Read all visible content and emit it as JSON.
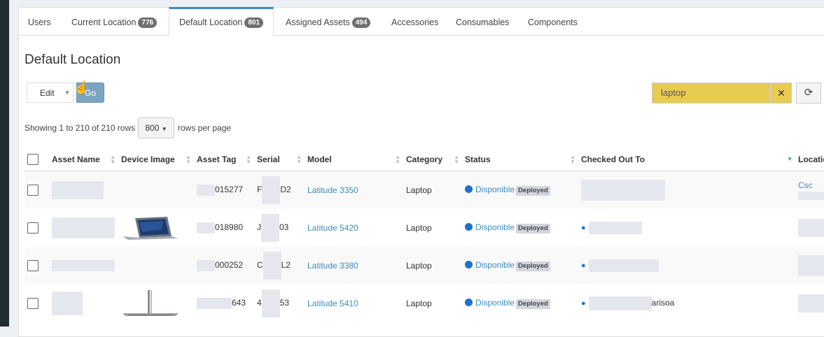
{
  "tabs": [
    {
      "label": "Users",
      "badge": ""
    },
    {
      "label": "Current Location",
      "badge": "776"
    },
    {
      "label": "Default Location",
      "badge": "801"
    },
    {
      "label": "Assigned Assets",
      "badge": "494"
    },
    {
      "label": "Accessories",
      "badge": ""
    },
    {
      "label": "Consumables",
      "badge": ""
    },
    {
      "label": "Components",
      "badge": ""
    }
  ],
  "page_title": "Default Location",
  "bulk": {
    "edit_label": "Edit",
    "go_label": "Go"
  },
  "search": {
    "value": "laptop",
    "clear_icon": "✕",
    "refresh_icon": "⟳"
  },
  "pagination": {
    "showing": "Showing 1 to 210 of 210 rows",
    "rows_value": "800",
    "rows_label": "rows per page"
  },
  "columns": [
    "Asset Name",
    "Device Image",
    "Asset Tag",
    "Serial",
    "Model",
    "Category",
    "Status",
    "Checked Out To",
    "Locatio"
  ],
  "rows": [
    {
      "tag": "015277",
      "serial_a": "F",
      "serial_b": "D2",
      "model": "Latitude 3350",
      "category": "Laptop",
      "status": "Disponible",
      "status_label": "Deployed",
      "location": "Csc"
    },
    {
      "tag": "018980",
      "serial_a": "J",
      "serial_b": "03",
      "model": "Latitude 5420",
      "category": "Laptop",
      "status": "Disponible",
      "status_label": "Deployed",
      "location": ""
    },
    {
      "tag": "000252",
      "serial_a": "C",
      "serial_b": "L2",
      "model": "Latitude 3380",
      "category": "Laptop",
      "status": "Disponible",
      "status_label": "Deployed",
      "location": ""
    },
    {
      "tag": "643",
      "serial_a": "4",
      "serial_b": "53",
      "model": "Latitude 5410",
      "category": "Laptop",
      "status": "Disponible",
      "status_label": "Deployed",
      "location": "",
      "checked_suffix": "arisoa"
    }
  ],
  "colors": {
    "accent": "#3c8dbc",
    "search_bg": "#e8cc52",
    "status_dot": "#1c73c7",
    "go_button": "#7ca4c0"
  }
}
